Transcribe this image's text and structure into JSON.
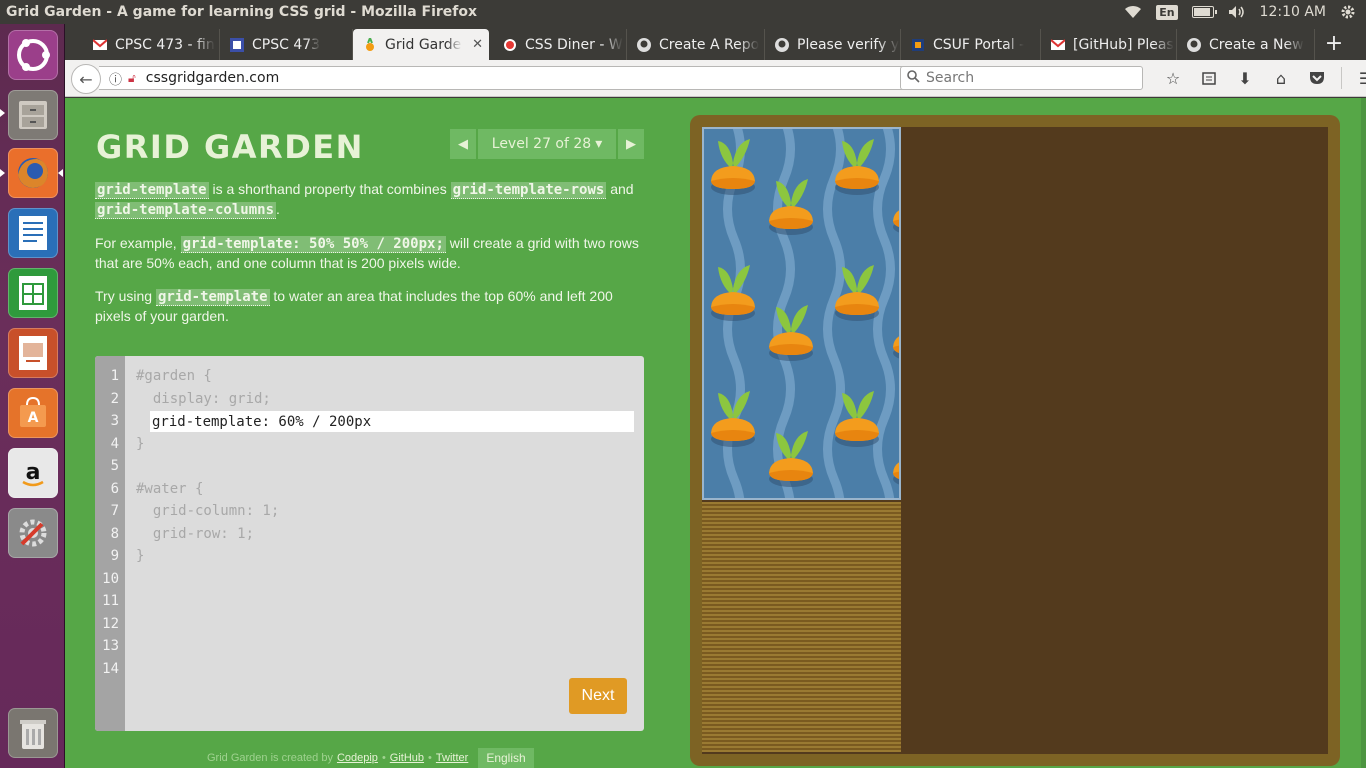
{
  "window_title": "Grid Garden - A game for learning CSS grid - Mozilla Firefox",
  "system_tray": {
    "keyboard_layout": "En",
    "battery_level": 0.8,
    "time": "12:10 AM"
  },
  "launcher": {
    "items": [
      "dash-home",
      "files",
      "firefox",
      "libreoffice-writer",
      "libreoffice-calc",
      "libreoffice-impress",
      "ubuntu-software",
      "amazon",
      "system-settings",
      "trash"
    ]
  },
  "tabs": [
    {
      "label": "CPSC 473 - fin",
      "icon": "gmail-icon"
    },
    {
      "label": "CPSC 473",
      "icon": "course-icon"
    },
    {
      "label": "Grid Garden",
      "icon": "carrot-icon",
      "active": true
    },
    {
      "label": "CSS Diner - W",
      "icon": "diner-icon"
    },
    {
      "label": "Create A Repo",
      "icon": "github-icon"
    },
    {
      "label": "Please verify y",
      "icon": "github-icon"
    },
    {
      "label": "CSUF Portal -",
      "icon": "csuf-icon"
    },
    {
      "label": "[GitHub] Pleas",
      "icon": "gmail-icon"
    },
    {
      "label": "Create a New",
      "icon": "github-icon"
    }
  ],
  "navbar": {
    "url": "cssgridgarden.com",
    "search_placeholder": "Search"
  },
  "game": {
    "logo": "GRID GARDEN",
    "level_label": "Level 27 of 28",
    "intro": {
      "code1": "grid-template",
      "t1": " is a shorthand property that combines ",
      "code2": "grid-template-rows",
      "t2": " and ",
      "code3": "grid-template-columns",
      "t3": "."
    },
    "example": {
      "t1": "For example, ",
      "code": "grid-template: 50% 50% / 200px;",
      "t2": " will create a grid with two rows that are 50% each, and one column that is 200 pixels wide."
    },
    "task": {
      "t1": "Try using ",
      "code": "grid-template",
      "t2": " to water an area that includes the top 60% and left 200 pixels of your garden."
    },
    "editor": {
      "line_numbers": [
        "1",
        "2",
        "3",
        "4",
        "5",
        "6",
        "7",
        "8",
        "9",
        "10",
        "11",
        "12",
        "13",
        "14"
      ],
      "line1": "#garden {",
      "line2": "  display: grid;",
      "input_value": "grid-template: 60% / 200px",
      "line4": "}",
      "line6": "#water {",
      "line7": "  grid-column: 1;",
      "line8": "  grid-row: 1;",
      "line9": "}"
    },
    "next_label": "Next",
    "footer": {
      "prefix": "Grid Garden is created by",
      "link1": "Codepip",
      "link2": "GitHub",
      "link3": "Twitter",
      "sep": "•",
      "language": "English"
    }
  },
  "colors": {
    "page_bg": "#56a747",
    "water": "#4b7ea8",
    "soil": "#533a1d",
    "next_button": "#e09a24"
  }
}
